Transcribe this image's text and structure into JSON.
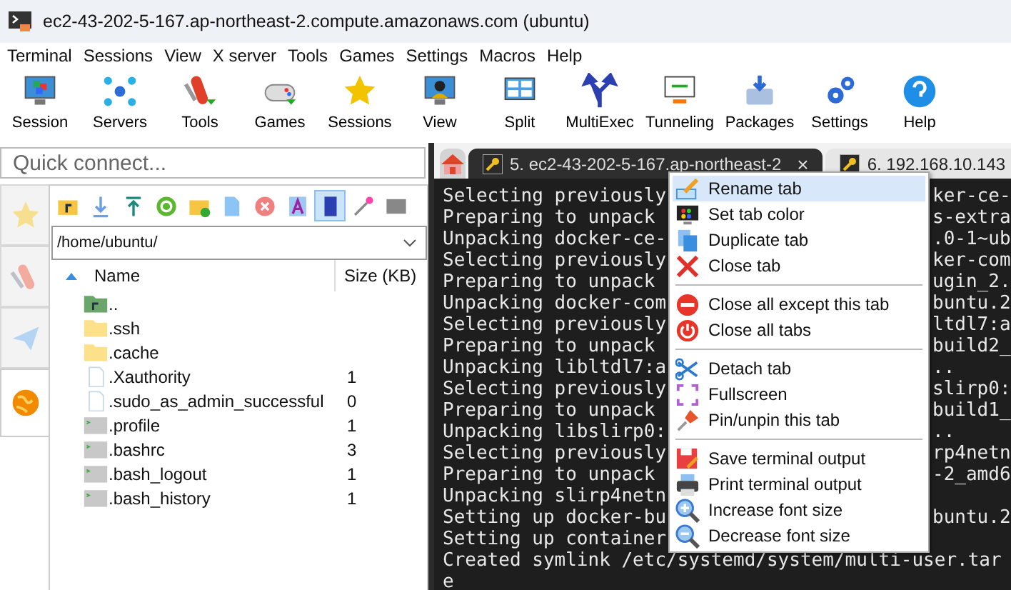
{
  "window": {
    "title": "ec2-43-202-5-167.ap-northeast-2.compute.amazonaws.com (ubuntu)"
  },
  "menu_bar": [
    "Terminal",
    "Sessions",
    "View",
    "X server",
    "Tools",
    "Games",
    "Settings",
    "Macros",
    "Help"
  ],
  "toolbar": [
    {
      "label": "Session"
    },
    {
      "label": "Servers"
    },
    {
      "label": "Tools"
    },
    {
      "label": "Games"
    },
    {
      "label": "Sessions"
    },
    {
      "label": "View"
    },
    {
      "label": "Split"
    },
    {
      "label": "MultiExec"
    },
    {
      "label": "Tunneling"
    },
    {
      "label": "Packages"
    },
    {
      "label": "Settings"
    },
    {
      "label": "Help"
    }
  ],
  "quick_connect": {
    "placeholder": "Quick connect..."
  },
  "side_tabs": [
    {
      "selected": false
    },
    {
      "selected": false
    },
    {
      "selected": false
    },
    {
      "selected": true
    }
  ],
  "file_tools": [
    {
      "selected": false
    },
    {
      "selected": false
    },
    {
      "selected": false
    },
    {
      "selected": false
    },
    {
      "selected": false
    },
    {
      "selected": false
    },
    {
      "selected": false
    },
    {
      "selected": false
    },
    {
      "selected": true
    },
    {
      "selected": false
    },
    {
      "selected": false
    }
  ],
  "file_browser": {
    "path": "/home/ubuntu/",
    "columns": [
      "Name",
      "Size (KB)"
    ],
    "files": [
      {
        "name": "..",
        "kind": "parent"
      },
      {
        "name": ".ssh",
        "kind": "folder"
      },
      {
        "name": ".cache",
        "kind": "folder"
      },
      {
        "name": ".Xauthority",
        "kind": "file",
        "size": "1"
      },
      {
        "name": ".sudo_as_admin_successful",
        "kind": "file",
        "size": "0"
      },
      {
        "name": ".profile",
        "kind": "script",
        "size": "1"
      },
      {
        "name": ".bashrc",
        "kind": "script",
        "size": "3"
      },
      {
        "name": ".bash_logout",
        "kind": "script",
        "size": "1"
      },
      {
        "name": ".bash_history",
        "kind": "script",
        "size": "1"
      }
    ]
  },
  "tabs": [
    {
      "kind": "home",
      "selected": false
    },
    {
      "kind": "ssh",
      "label": "5. ec2-43-202-5-167.ap-northeast-2",
      "close": "×",
      "selected": true
    },
    {
      "kind": "ssh",
      "label": "6. 192.168.10.143",
      "selected": false
    }
  ],
  "terminal": [
    {
      "left": "Selecting previously",
      "right": "ker-ce-"
    },
    {
      "left": "Preparing to unpack",
      "right": "s-extra"
    },
    {
      "left": "Unpacking docker-ce-",
      "right": ".0-1~ub"
    },
    {
      "left": "Selecting previously",
      "right": "ker-com"
    },
    {
      "left": "Preparing to unpack",
      "right": "ugin_2."
    },
    {
      "left": "Unpacking docker-com",
      "right": "buntu.2"
    },
    {
      "left": "Selecting previously",
      "right": "ltdl7:a"
    },
    {
      "left": "Preparing to unpack",
      "right": "build2_"
    },
    {
      "left": "Unpacking libltdl7:a",
      "right": ".."
    },
    {
      "left": "Selecting previously",
      "right": "slirp0:"
    },
    {
      "left": "Preparing to unpack",
      "right": "build1_"
    },
    {
      "left": "Unpacking libslirp0:",
      "right": ".."
    },
    {
      "left": "Selecting previously",
      "right": "rp4netn"
    },
    {
      "left": "Preparing to unpack",
      "right": "-2_amd6"
    },
    {
      "left": "Unpacking slirp4netn"
    },
    {
      "left": "Setting up docker-bu",
      "right": "buntu.2"
    },
    {
      "left": "Setting up container"
    },
    {
      "left": "Created symlink /etc/systemd/system/multi-user.tar"
    },
    {
      "left": "e"
    }
  ],
  "context_menu": [
    [
      {
        "label": "Rename tab",
        "selected": true
      },
      {
        "label": "Set tab color",
        "selected": false
      },
      {
        "label": "Duplicate tab",
        "selected": false
      },
      {
        "label": "Close tab",
        "selected": false
      }
    ],
    [
      {
        "label": "Close all except this tab",
        "selected": false
      },
      {
        "label": "Close all tabs",
        "selected": false
      }
    ],
    [
      {
        "label": "Detach tab",
        "selected": false
      },
      {
        "label": "Fullscreen",
        "selected": false
      },
      {
        "label": "Pin/unpin this tab",
        "selected": false
      }
    ],
    [
      {
        "label": "Save terminal output",
        "selected": false
      },
      {
        "label": "Print terminal output",
        "selected": false
      },
      {
        "label": "Increase font size",
        "selected": false
      },
      {
        "label": "Decrease font size",
        "selected": false
      }
    ]
  ]
}
